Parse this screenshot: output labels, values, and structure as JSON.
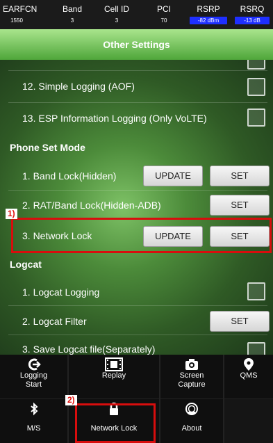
{
  "status_bar": {
    "columns": [
      {
        "header": "EARFCN",
        "value": "1550",
        "highlight": false
      },
      {
        "header": "Band",
        "value": "3",
        "highlight": false
      },
      {
        "header": "Cell ID",
        "value": "3",
        "highlight": false
      },
      {
        "header": "PCI",
        "value": "70",
        "highlight": false
      },
      {
        "header": "RSRP",
        "value": "-82 dBm",
        "highlight": true
      },
      {
        "header": "RSRQ",
        "value": "-13 dB",
        "highlight": true
      }
    ],
    "highlight_color": "#1e2fff"
  },
  "title": "Other Settings",
  "settings": {
    "simple_logging": "12. Simple Logging (AOF)",
    "esp_logging": "13. ESP Information Logging (Only VoLTE)",
    "phone_set_mode": {
      "heading": "Phone Set Mode",
      "band_lock": "1. Band Lock(Hidden)",
      "rat_band_lock": "2. RAT/Band Lock(Hidden-ADB)",
      "network_lock": "3. Network Lock"
    },
    "logcat": {
      "heading": "Logcat",
      "logging": "1. Logcat Logging",
      "filter": "2. Logcat Filter",
      "save_file": "3. Save Logcat file(Separately)"
    }
  },
  "buttons": {
    "update": "UPDATE",
    "set": "SET"
  },
  "annotations": {
    "one": "1)",
    "two": "2)",
    "color": "#d80d0d"
  },
  "bottom_tabs": {
    "logging_start": {
      "line1": "Logging",
      "line2": "Start",
      "icon": "logging-start-icon"
    },
    "replay": {
      "label": "Replay",
      "icon": "film-icon"
    },
    "screen_capture": {
      "line1": "Screen",
      "line2": "Capture",
      "icon": "camera-icon"
    },
    "qms": {
      "label": "QMS",
      "icon": "location-pin-icon"
    },
    "ms": {
      "label": "M/S",
      "icon": "bluetooth-icon"
    },
    "network_lock": {
      "label": "Network Lock",
      "icon": "lock-icon"
    },
    "about": {
      "label": "About",
      "icon": "about-icon"
    }
  },
  "colors": {
    "title_bar": "#6fc050",
    "accent_green": "#4fa63a"
  }
}
